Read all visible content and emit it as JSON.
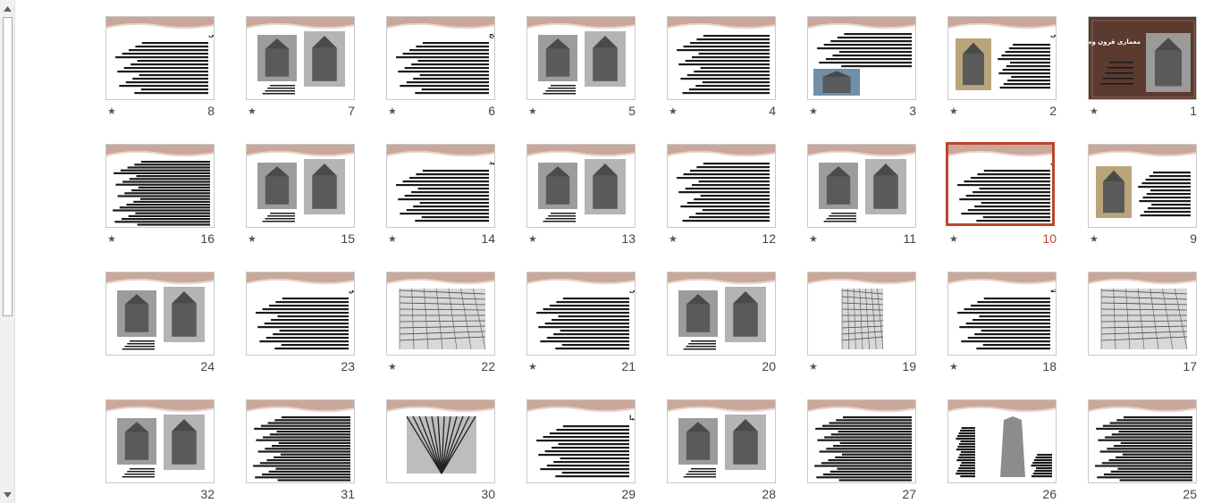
{
  "accent_color": "#c0442a",
  "selected_slide": "10",
  "scrollbar": {
    "up_icon": "triangle-up",
    "down_icon": "triangle-down"
  },
  "slides": [
    {
      "num": "1",
      "title": "معماری قرون وسطی",
      "star": "★",
      "layout": "cover"
    },
    {
      "num": "2",
      "title": "قرون وسطی",
      "star": "★",
      "layout": "text-img"
    },
    {
      "num": "3",
      "title": "",
      "star": "★",
      "layout": "img-text"
    },
    {
      "num": "4",
      "title": "",
      "star": "★",
      "layout": "text"
    },
    {
      "num": "5",
      "title": "",
      "star": "★",
      "layout": "two-img"
    },
    {
      "num": "6",
      "title": "مصالح",
      "star": "★",
      "layout": "text"
    },
    {
      "num": "7",
      "title": "",
      "star": "★",
      "layout": "two-img"
    },
    {
      "num": "8",
      "title": "طراحی",
      "star": "★",
      "layout": "text"
    },
    {
      "num": "9",
      "title": "",
      "star": "★",
      "layout": "text-img"
    },
    {
      "num": "10",
      "title": "بناها ساخته شده در قرون وسطی",
      "star": "★",
      "layout": "text"
    },
    {
      "num": "11",
      "title": "",
      "star": "★",
      "layout": "two-img"
    },
    {
      "num": "12",
      "title": "",
      "star": "★",
      "layout": "text"
    },
    {
      "num": "13",
      "title": "",
      "star": "★",
      "layout": "two-img"
    },
    {
      "num": "14",
      "title": "نظم جدید",
      "star": "★",
      "layout": "text"
    },
    {
      "num": "15",
      "title": "",
      "star": "★",
      "layout": "two-img"
    },
    {
      "num": "16",
      "title": "",
      "star": "★",
      "layout": "dense"
    },
    {
      "num": "17",
      "title": "",
      "star": "",
      "layout": "map"
    },
    {
      "num": "18",
      "title": "نقشه تمدن های چه",
      "star": "★",
      "layout": "text"
    },
    {
      "num": "19",
      "title": "",
      "star": "★",
      "layout": "map-small"
    },
    {
      "num": "20",
      "title": "",
      "star": "",
      "layout": "two-img"
    },
    {
      "num": "21",
      "title": "ظهور فرانک ها و هجوم اسلامی",
      "star": "★",
      "layout": "text"
    },
    {
      "num": "22",
      "title": "",
      "star": "★",
      "layout": "map"
    },
    {
      "num": "23",
      "title": "کلیسای فلورانس",
      "star": "",
      "layout": "text"
    },
    {
      "num": "24",
      "title": "",
      "star": "",
      "layout": "two-img"
    },
    {
      "num": "25",
      "title": "",
      "star": "",
      "layout": "dense"
    },
    {
      "num": "26",
      "title": "",
      "star": "",
      "layout": "tower"
    },
    {
      "num": "27",
      "title": "",
      "star": "",
      "layout": "dense"
    },
    {
      "num": "28",
      "title": "",
      "star": "",
      "layout": "two-img"
    },
    {
      "num": "29",
      "title": "رنسانس در ایتالیا",
      "star": "",
      "layout": "text"
    },
    {
      "num": "30",
      "title": "",
      "star": "",
      "layout": "vault"
    },
    {
      "num": "31",
      "title": "",
      "star": "",
      "layout": "dense"
    },
    {
      "num": "32",
      "title": "",
      "star": "",
      "layout": "two-img"
    }
  ]
}
